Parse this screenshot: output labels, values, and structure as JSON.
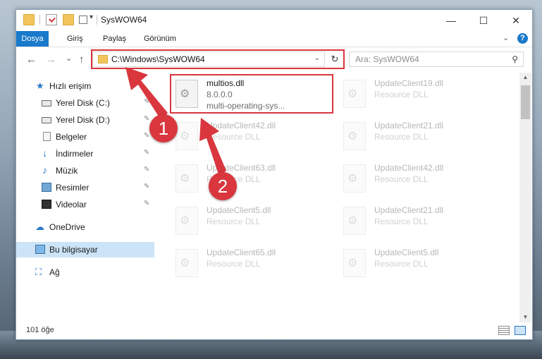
{
  "window": {
    "title": "SysWOW64",
    "minimize_glyph": "—",
    "maximize_glyph": "☐",
    "close_glyph": "✕"
  },
  "ribbon": {
    "tabs": [
      {
        "label": "Dosya",
        "active": true
      },
      {
        "label": "Giriş"
      },
      {
        "label": "Paylaş"
      },
      {
        "label": "Görünüm"
      }
    ],
    "collapse_glyph": "⌄",
    "help_glyph": "?"
  },
  "nav": {
    "back_glyph": "←",
    "forward_glyph": "→",
    "recent_glyph": "⌄",
    "up_glyph": "↑",
    "address": "C:\\Windows\\SysWOW64",
    "address_dropdown_glyph": "⌄",
    "refresh_glyph": "↻",
    "search_placeholder": "Ara: SysWOW64",
    "search_glyph": "⚲"
  },
  "sidebar": {
    "items": [
      {
        "label": "Hızlı erişim",
        "icon": "star-icon",
        "glyph": "★"
      },
      {
        "label": "Yerel Disk (C:)",
        "icon": "drive-icon",
        "pinned": true
      },
      {
        "label": "Yerel Disk (D:)",
        "icon": "drive-icon",
        "pinned": true
      },
      {
        "label": "Belgeler",
        "icon": "document-icon",
        "pinned": true
      },
      {
        "label": "İndirmeler",
        "icon": "download-icon",
        "glyph": "↓",
        "pinned": true
      },
      {
        "label": "Müzik",
        "icon": "music-icon",
        "glyph": "♪",
        "pinned": true
      },
      {
        "label": "Resimler",
        "icon": "pictures-icon",
        "pinned": true
      },
      {
        "label": "Videolar",
        "icon": "video-icon",
        "pinned": true
      },
      {
        "label": "OneDrive",
        "icon": "cloud-icon",
        "glyph": "☁"
      },
      {
        "label": "Bu bilgisayar",
        "icon": "computer-icon",
        "selected": true
      },
      {
        "label": "Ağ",
        "icon": "network-icon",
        "glyph": "⛶"
      }
    ],
    "pin_glyph": "📌"
  },
  "files": {
    "highlighted": {
      "name": "multios.dll",
      "version": "8.0.0.0",
      "description": "multi-operating-sys..."
    },
    "left_column": [
      {
        "name": "UpdateClient42.dll",
        "type": "Resource DLL"
      },
      {
        "name": "UpdateClient63.dll",
        "type": "Resource DLL"
      },
      {
        "name": "UpdateClient5.dll",
        "type": "Resource DLL"
      },
      {
        "name": "UpdateClient65.dll",
        "type": "Resource DLL"
      }
    ],
    "right_column": [
      {
        "name": "UpdateClient19.dll",
        "type": "Resource DLL"
      },
      {
        "name": "UpdateClient21.dll",
        "type": "Resource DLL"
      },
      {
        "name": "UpdateClient42.dll",
        "type": "Resource DLL"
      },
      {
        "name": "UpdateClient21.dll",
        "type": "Resource DLL"
      },
      {
        "name": "UpdateClient5.dll",
        "type": "Resource DLL"
      }
    ]
  },
  "status": {
    "item_count": "101 öğe"
  },
  "callouts": [
    {
      "number": "1"
    },
    {
      "number": "2"
    }
  ],
  "colors": {
    "accent": "#1979ca",
    "callout": "#d9363e",
    "selection": "#cce4f7"
  }
}
